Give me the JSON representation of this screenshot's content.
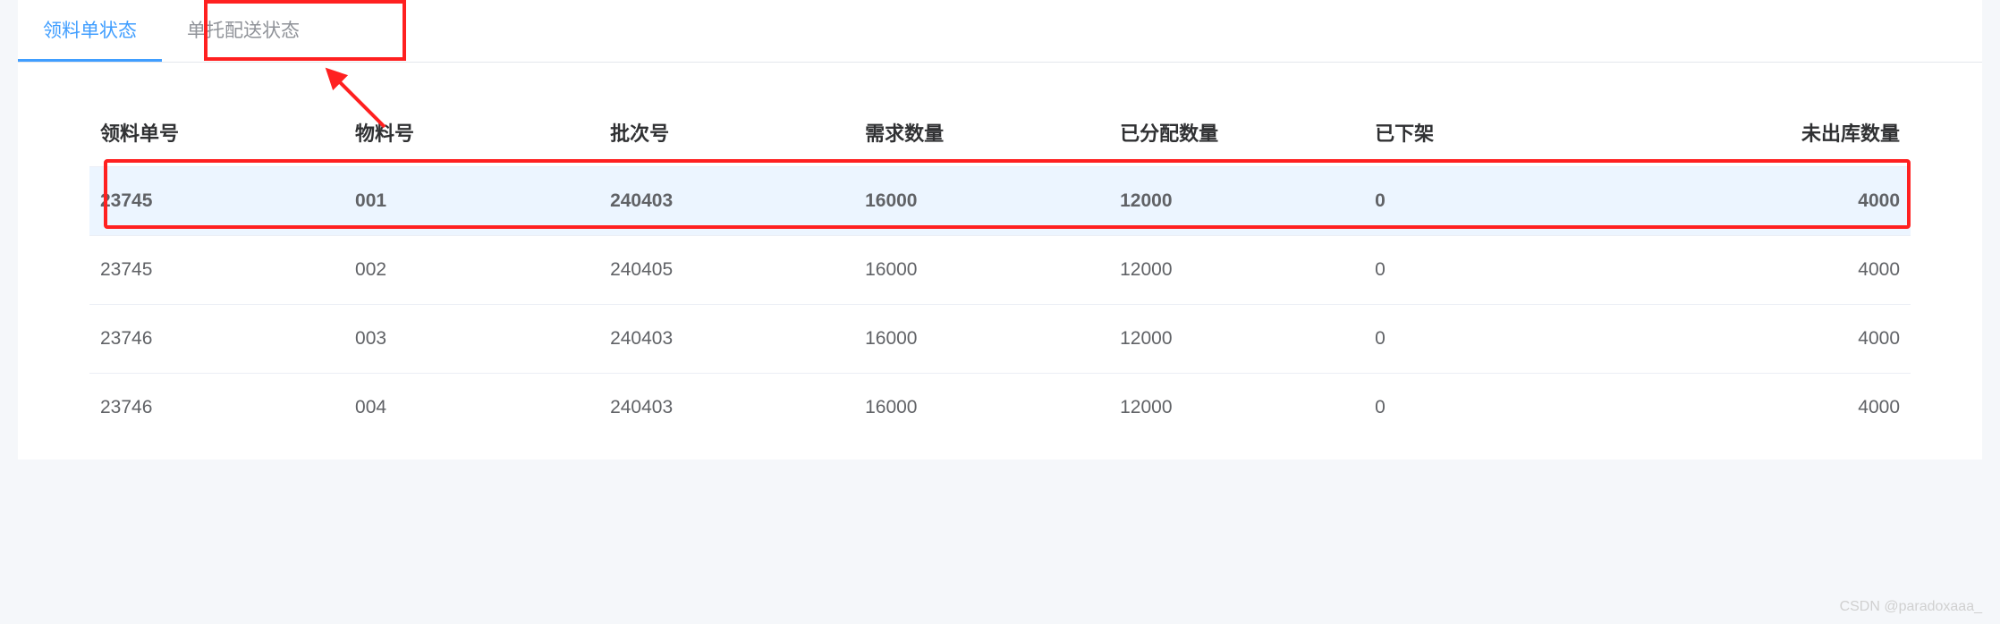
{
  "tabs": [
    {
      "label": "领料单状态",
      "active": true
    },
    {
      "label": "单托配送状态",
      "active": false
    }
  ],
  "table": {
    "headers": [
      "领料单号",
      "物料号",
      "批次号",
      "需求数量",
      "已分配数量",
      "已下架",
      "未出库数量"
    ],
    "rows": [
      {
        "cells": [
          "23745",
          "001",
          "240403",
          "16000",
          "12000",
          "0",
          "4000"
        ],
        "highlighted": true
      },
      {
        "cells": [
          "23745",
          "002",
          "240405",
          "16000",
          "12000",
          "0",
          "4000"
        ],
        "highlighted": false
      },
      {
        "cells": [
          "23746",
          "003",
          "240403",
          "16000",
          "12000",
          "0",
          "4000"
        ],
        "highlighted": false
      },
      {
        "cells": [
          "23746",
          "004",
          "240403",
          "16000",
          "12000",
          "0",
          "4000"
        ],
        "highlighted": false
      }
    ]
  },
  "watermark": "CSDN @paradoxaaa_"
}
